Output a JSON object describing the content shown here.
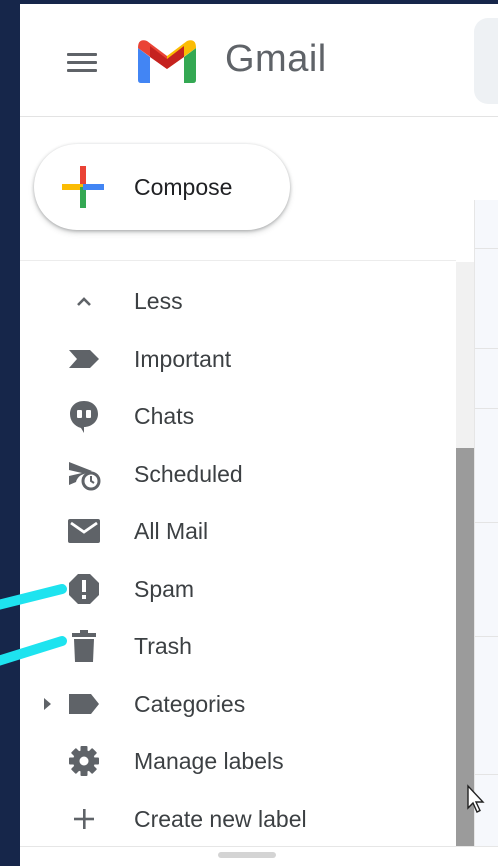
{
  "header": {
    "app_name": "Gmail"
  },
  "compose": {
    "label": "Compose"
  },
  "nav": {
    "items": [
      {
        "label": "Less",
        "icon": "chevron-up-icon"
      },
      {
        "label": "Important",
        "icon": "important-label-icon"
      },
      {
        "label": "Chats",
        "icon": "chat-bubble-icon"
      },
      {
        "label": "Scheduled",
        "icon": "scheduled-send-icon"
      },
      {
        "label": "All Mail",
        "icon": "envelope-icon"
      },
      {
        "label": "Spam",
        "icon": "exclamation-octagon-icon"
      },
      {
        "label": "Trash",
        "icon": "trash-icon"
      },
      {
        "label": "Categories",
        "icon": "label-tag-icon"
      },
      {
        "label": "Manage labels",
        "icon": "gear-icon"
      },
      {
        "label": "Create new label",
        "icon": "plus-icon"
      }
    ]
  },
  "colors": {
    "background": "#16264a",
    "annotation": "#1ee3ef",
    "icon_gray": "#5f6368",
    "text": "#3c4043",
    "scroll_thumb": "#9b9b9b"
  }
}
